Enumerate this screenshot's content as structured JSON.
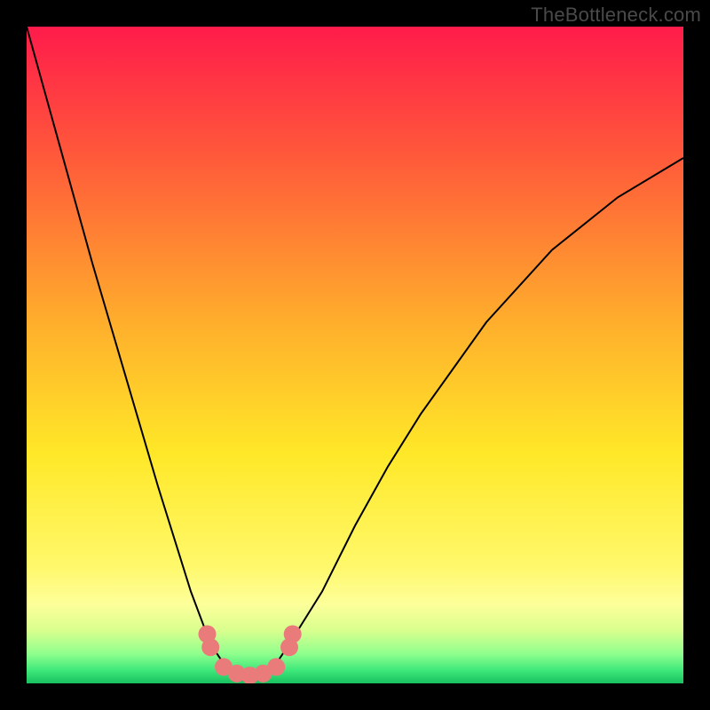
{
  "watermark": "TheBottleneck.com",
  "chart_data": {
    "type": "line",
    "title": "",
    "xlabel": "",
    "ylabel": "",
    "xlim": [
      0,
      100
    ],
    "ylim": [
      0,
      100
    ],
    "series": [
      {
        "name": "bottleneck-curve",
        "x": [
          0,
          5,
          10,
          15,
          20,
          25,
          28,
          30,
          32,
          34,
          36,
          38,
          40,
          45,
          50,
          55,
          60,
          70,
          80,
          90,
          100
        ],
        "y": [
          100,
          82,
          64,
          47,
          30,
          14,
          6,
          3,
          1.5,
          1,
          1.5,
          3,
          6,
          14,
          24,
          33,
          41,
          55,
          66,
          74,
          80
        ]
      }
    ],
    "markers": {
      "name": "highlight-dots",
      "x": [
        27.5,
        28,
        30,
        32,
        34,
        36,
        38,
        40,
        40.5
      ],
      "y": [
        7.5,
        5.5,
        2.5,
        1.5,
        1.2,
        1.5,
        2.5,
        5.5,
        7.5
      ]
    },
    "background_gradient": {
      "stops": [
        {
          "pos": 0.0,
          "color": "#ff1b4b"
        },
        {
          "pos": 0.2,
          "color": "#ff5a3a"
        },
        {
          "pos": 0.45,
          "color": "#ffae2c"
        },
        {
          "pos": 0.65,
          "color": "#ffe828"
        },
        {
          "pos": 0.82,
          "color": "#fff86a"
        },
        {
          "pos": 0.88,
          "color": "#fdff9a"
        },
        {
          "pos": 0.92,
          "color": "#d8ff8e"
        },
        {
          "pos": 0.955,
          "color": "#8fff8e"
        },
        {
          "pos": 0.98,
          "color": "#3fe87a"
        },
        {
          "pos": 1.0,
          "color": "#18c060"
        }
      ]
    }
  }
}
